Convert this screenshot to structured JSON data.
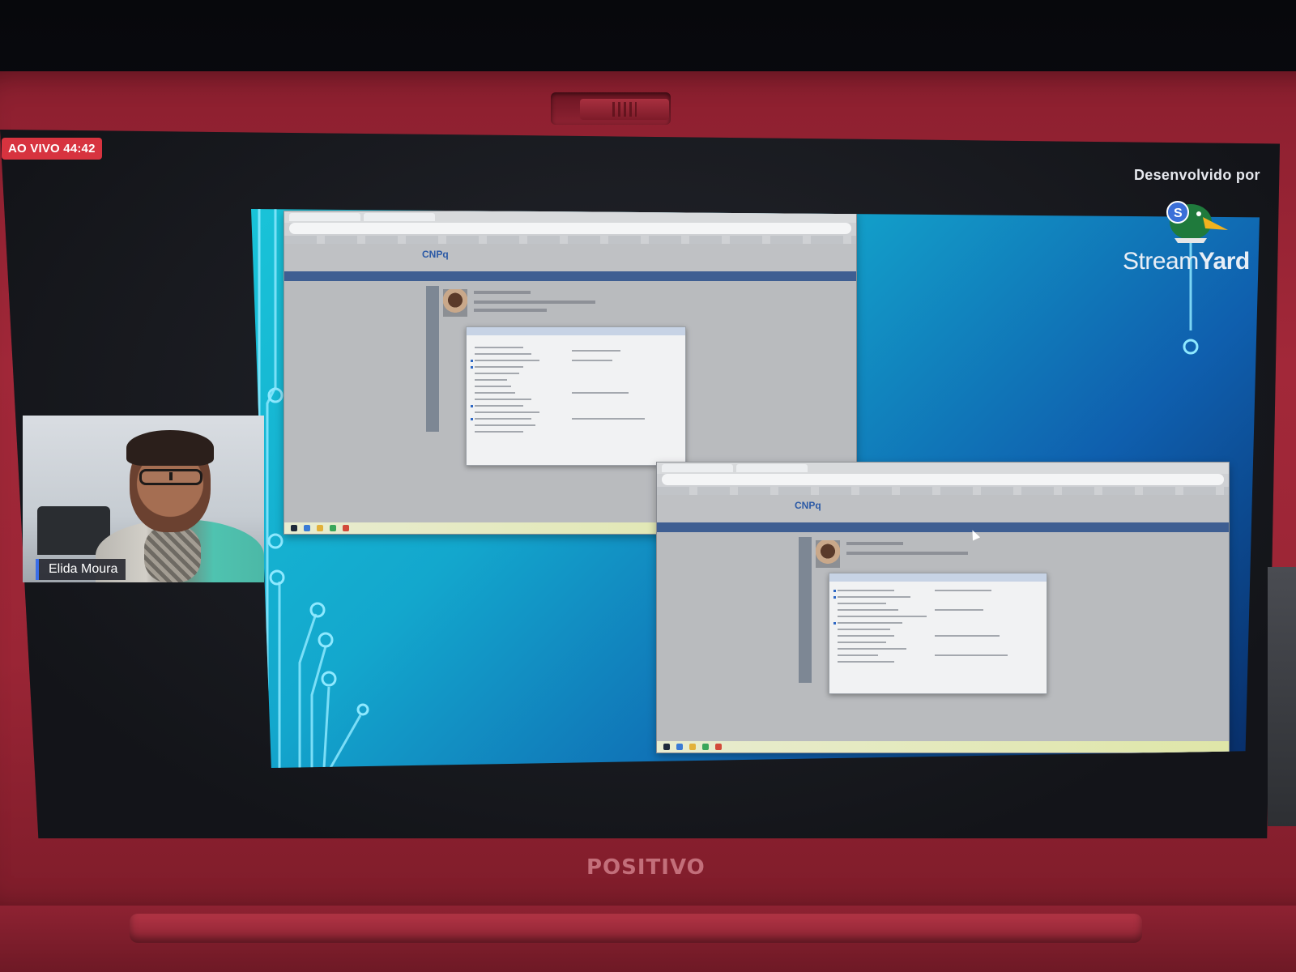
{
  "live": {
    "label": "AO VIVO 44:42"
  },
  "branding": {
    "developed_by": "Desenvolvido por",
    "name_part1": "Stream",
    "name_part2": "Yard",
    "logo_icon": "streamyard-duck-logo-icon"
  },
  "participant": {
    "name": "Elida Moura"
  },
  "laptop": {
    "brand": "POSITIVO"
  },
  "shared_screen": {
    "site_logo": "CNPq"
  },
  "colors": {
    "live_badge": "#d7333f",
    "name_tag_accent": "#3a6ee8",
    "laptop_body": "#a22839",
    "stage_gradient_start": "#19c3d8",
    "stage_gradient_end": "#082c66"
  }
}
